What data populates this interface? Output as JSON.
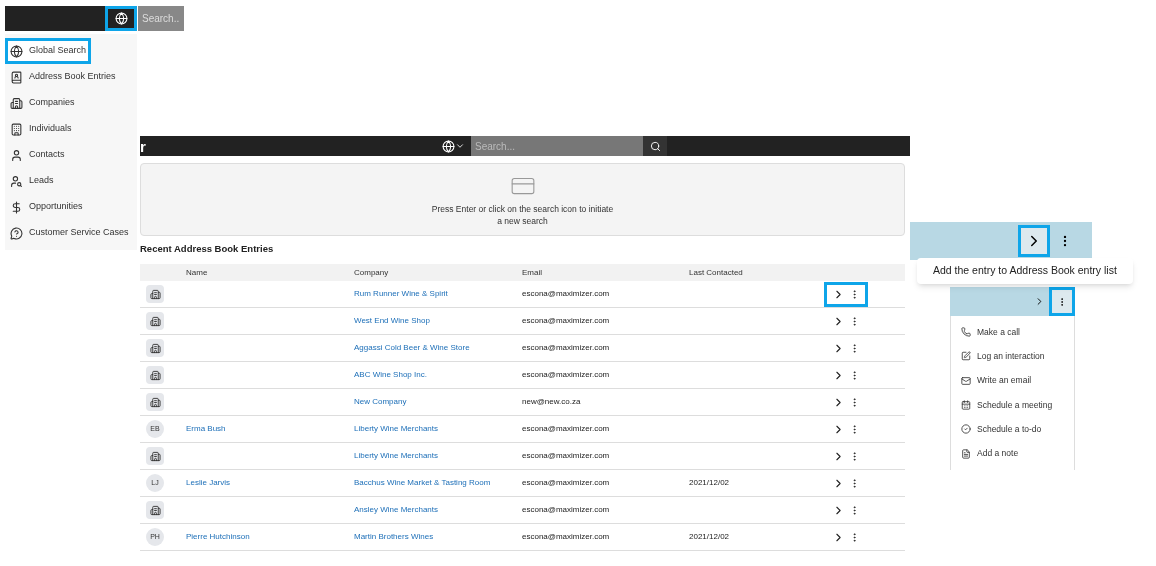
{
  "search_dropdown": {
    "search": {
      "placeholder": "Search..."
    },
    "scope_button": {
      "highlighted": true
    },
    "items": [
      {
        "label": "Global Search",
        "highlighted": true
      },
      {
        "label": "Address Book Entries",
        "highlighted": false
      },
      {
        "label": "Companies",
        "highlighted": false
      },
      {
        "label": "Individuals",
        "highlighted": false
      },
      {
        "label": "Contacts",
        "highlighted": false
      },
      {
        "label": "Leads",
        "highlighted": false
      },
      {
        "label": "Opportunities",
        "highlighted": false
      },
      {
        "label": "Customer Service Cases",
        "highlighted": false
      }
    ]
  },
  "main": {
    "header_title": "r",
    "search": {
      "placeholder": "Search..."
    },
    "empty_state": "Press Enter or click on the search icon to initiate\na new search",
    "section_title": "Recent Address Book Entries",
    "table": {
      "columns": [
        "Name",
        "Company",
        "Email",
        "Last Contacted"
      ],
      "rows": [
        {
          "kind": "company",
          "company": "Rum Runner Wine & Spirit",
          "email": "escona@maximizer.com",
          "highlighted": true
        },
        {
          "kind": "company",
          "company": "West End Wine Shop",
          "email": "escona@maximizer.com",
          "highlighted": false
        },
        {
          "kind": "company",
          "company": "Aggassi Cold Beer & Wine Store",
          "email": "escona@maximizer.com",
          "highlighted": false
        },
        {
          "kind": "company",
          "company": "ABC Wine Shop Inc.",
          "email": "escona@maximizer.com",
          "highlighted": false
        },
        {
          "kind": "company",
          "company": "New Company",
          "email": "new@new.co.za",
          "highlighted": false
        },
        {
          "kind": "person",
          "initials": "EB",
          "name": "Erma Bush",
          "company": "Liberty Wine Merchants",
          "email": "escona@maximizer.com",
          "highlighted": false
        },
        {
          "kind": "company",
          "company": "Liberty Wine Merchants",
          "email": "escona@maximizer.com",
          "highlighted": false
        },
        {
          "kind": "person",
          "initials": "LJ",
          "name": "Leslie Jarvis",
          "company": "Bacchus Wine Market & Tasting Room",
          "email": "escona@maximizer.com",
          "last_contacted": "2021/12/02",
          "highlighted": false
        },
        {
          "kind": "company",
          "company": "Ansley Wine Merchants",
          "email": "escona@maximizer.com",
          "highlighted": false
        },
        {
          "kind": "person",
          "initials": "PH",
          "name": "Pierre Hutchinson",
          "company": "Martin Brothers Wines",
          "email": "escona@maximizer.com",
          "last_contacted": "2021/12/02",
          "highlighted": false
        }
      ]
    }
  },
  "detail": {
    "add_button": {
      "highlighted": true
    },
    "tooltip": "Add the entry to Address Book entry list",
    "more_button": {
      "highlighted": true
    },
    "menu": [
      {
        "label": "Make a call"
      },
      {
        "label": "Log an interaction"
      },
      {
        "label": "Write an email"
      },
      {
        "label": "Schedule a meeting"
      },
      {
        "label": "Schedule a to-do"
      },
      {
        "label": "Add a note"
      }
    ]
  }
}
